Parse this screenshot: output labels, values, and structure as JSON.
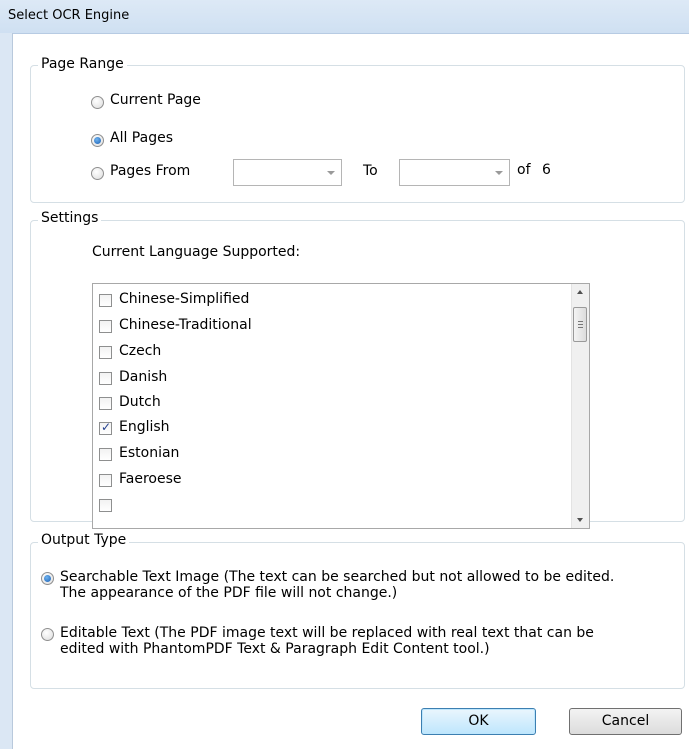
{
  "window": {
    "title": "Select OCR Engine"
  },
  "page_range": {
    "legend": "Page Range",
    "current_page": "Current Page",
    "all_pages": "All Pages",
    "pages_from": "Pages From",
    "from_value": "",
    "to_label": "To",
    "to_value": "",
    "of_label": "of",
    "page_count": "6",
    "selected": "all_pages"
  },
  "settings": {
    "legend": "Settings",
    "language_label": "Current Language Supported:",
    "languages": [
      {
        "name": "Chinese-Simplified",
        "checked": false
      },
      {
        "name": "Chinese-Traditional",
        "checked": false
      },
      {
        "name": "Czech",
        "checked": false
      },
      {
        "name": "Danish",
        "checked": false
      },
      {
        "name": "Dutch",
        "checked": false
      },
      {
        "name": "English",
        "checked": true
      },
      {
        "name": "Estonian",
        "checked": false
      },
      {
        "name": "Faeroese",
        "checked": false
      }
    ]
  },
  "output_type": {
    "legend": "Output Type",
    "searchable_line1": "Searchable Text Image (The text can be searched but not allowed to be edited.",
    "searchable_line2": "The appearance of the PDF file will not change.)",
    "editable_line1": "Editable Text (The PDF image text will be replaced with real text that can be",
    "editable_line2": "edited with PhantomPDF Text & Paragraph Edit Content tool.)",
    "selected": "searchable"
  },
  "buttons": {
    "ok": "OK",
    "cancel": "Cancel"
  }
}
